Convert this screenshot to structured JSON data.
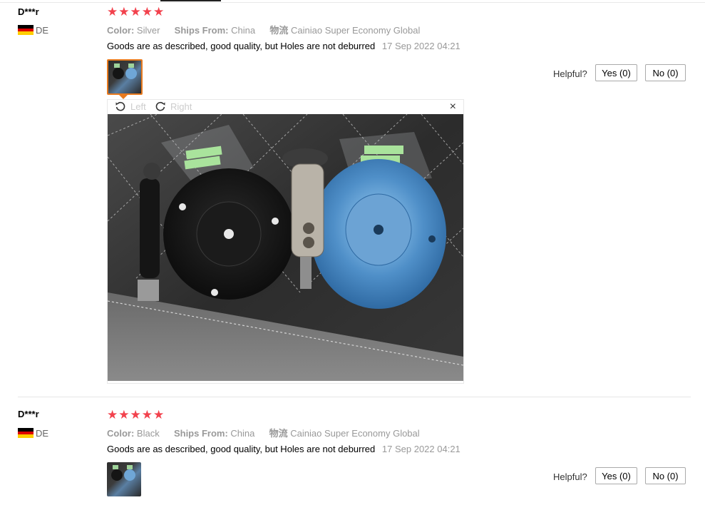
{
  "reviews": [
    {
      "user": "D***r",
      "country": "DE",
      "stars": 5,
      "props": [
        {
          "key": "Color:",
          "value": "Silver"
        },
        {
          "key": "Ships From:",
          "value": "China"
        },
        {
          "key": "物流",
          "value": "Cainiao Super Economy Global"
        }
      ],
      "text": "Goods are as described, good quality, but Holes are not deburred",
      "date": "17 Sep 2022 04:21",
      "helpful_label": "Helpful?",
      "yes_label": "Yes (0)",
      "no_label": "No (0)"
    },
    {
      "user": "D***r",
      "country": "DE",
      "stars": 5,
      "props": [
        {
          "key": "Color:",
          "value": "Black"
        },
        {
          "key": "Ships From:",
          "value": "China"
        },
        {
          "key": "物流",
          "value": "Cainiao Super Economy Global"
        }
      ],
      "text": "Goods are as described, good quality, but Holes are not deburred",
      "date": "17 Sep 2022 04:21",
      "helpful_label": "Helpful?",
      "yes_label": "Yes (0)",
      "no_label": "No (0)"
    }
  ],
  "viewer": {
    "rotate_left_label": "Left",
    "rotate_right_label": "Right",
    "close_glyph": "×"
  },
  "icons": {
    "star": "★",
    "rotate_left": "rotate-left-icon",
    "rotate_right": "rotate-right-icon",
    "close": "close-icon"
  },
  "colors": {
    "star": "#f2424d",
    "thumb_active_border": "#e87a1e"
  }
}
